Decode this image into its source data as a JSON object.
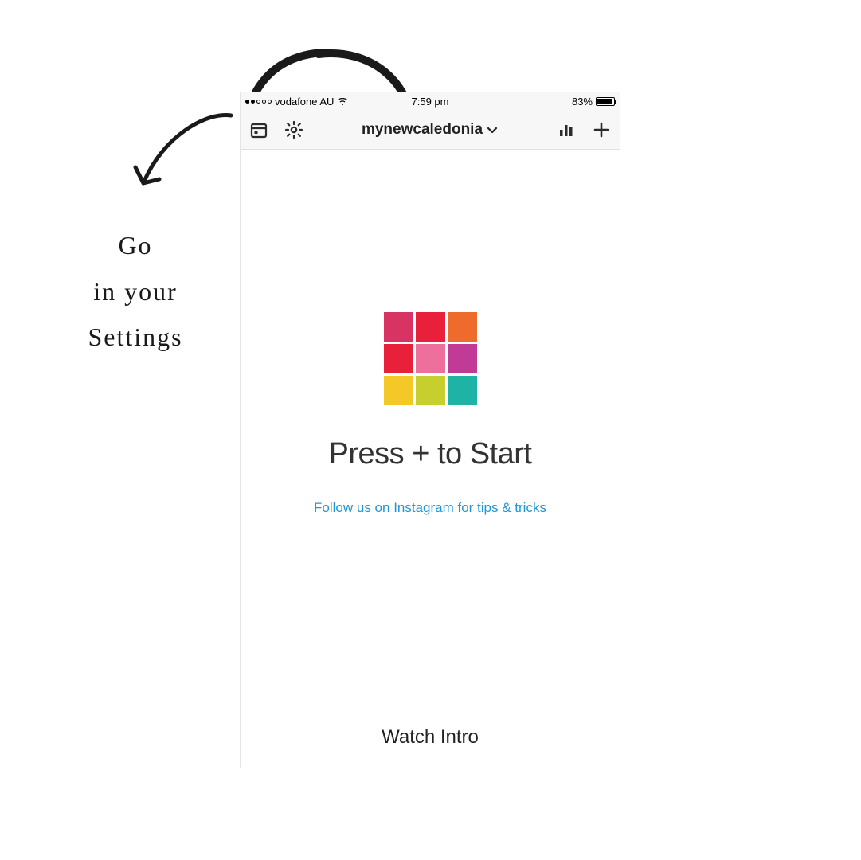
{
  "annotation": {
    "line1": "Go",
    "line2": "in your",
    "line3": "Settings"
  },
  "status_bar": {
    "signal_filled": 2,
    "signal_total": 5,
    "carrier": "vodafone AU",
    "time": "7:59 pm",
    "battery_percent_label": "83%",
    "battery_fill_percent": 83
  },
  "nav": {
    "account_name": "mynewcaledonia",
    "icons": {
      "calendar": "calendar-icon",
      "settings": "gear-icon",
      "stats": "stats-icon",
      "add": "plus-icon",
      "dropdown": "chevron-down-icon"
    }
  },
  "main": {
    "headline": "Press + to Start",
    "follow_link": "Follow us on Instagram for tips & tricks",
    "watch_intro": "Watch Intro",
    "logo_colors": [
      "#d73363",
      "#e9203a",
      "#ef6b2b",
      "#e9203a",
      "#ef6f9c",
      "#c03a96",
      "#f3c827",
      "#c7cf2e",
      "#1fb3a6"
    ]
  },
  "colors": {
    "link": "#2196d6"
  }
}
